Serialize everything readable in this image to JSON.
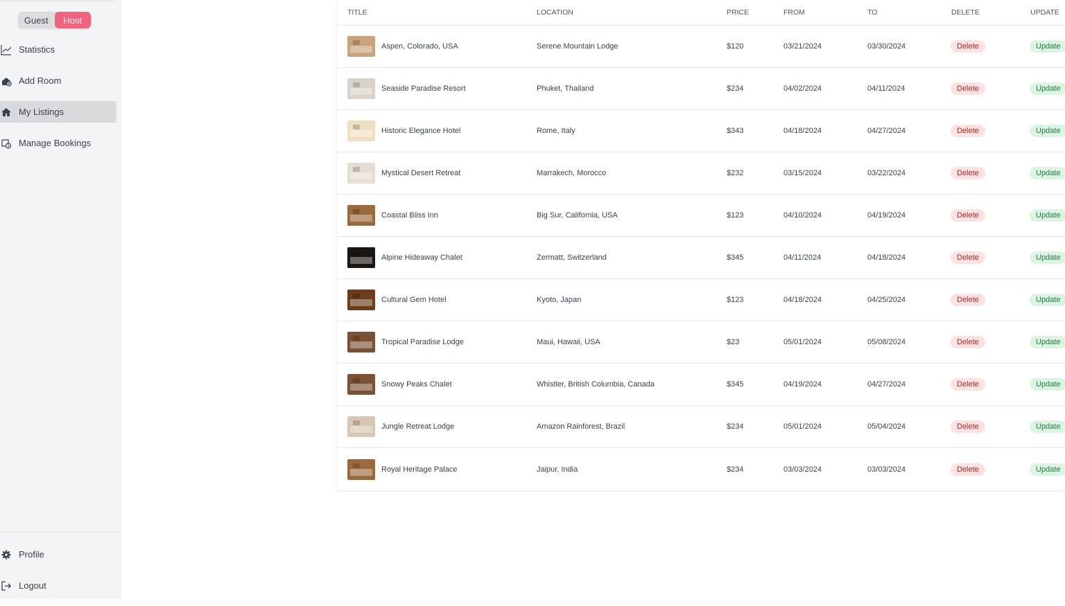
{
  "role_toggle": {
    "guest_label": "Guest",
    "host_label": "Host",
    "active": "host"
  },
  "sidebar": {
    "items": [
      {
        "label": "Statistics",
        "icon": "chart-line-icon",
        "active": false
      },
      {
        "label": "Add Room",
        "icon": "add-room-icon",
        "active": false
      },
      {
        "label": "My Listings",
        "icon": "home-icon",
        "active": true
      },
      {
        "label": "Manage Bookings",
        "icon": "bookings-icon",
        "active": false
      }
    ],
    "bottom": [
      {
        "label": "Profile",
        "icon": "gear-icon"
      },
      {
        "label": "Logout",
        "icon": "logout-icon"
      }
    ]
  },
  "table": {
    "headers": {
      "title": "Title",
      "location": "Location",
      "price": "Price",
      "from": "From",
      "to": "To",
      "delete": "Delete",
      "update": "Update"
    },
    "delete_label": "Delete",
    "update_label": "Update",
    "rows": [
      {
        "title": "Aspen, Colorado, USA",
        "location": "Serene Mountain Lodge",
        "price": "$120",
        "from": "03/21/2024",
        "to": "03/30/2024",
        "thumb": "#c9a47a"
      },
      {
        "title": "Seaside Paradise Resort",
        "location": "Phuket, Thailand",
        "price": "$234",
        "from": "04/02/2024",
        "to": "04/11/2024",
        "thumb": "#d8d2ca"
      },
      {
        "title": "Historic Elegance Hotel",
        "location": "Rome, Italy",
        "price": "$343",
        "from": "04/18/2024",
        "to": "04/27/2024",
        "thumb": "#f1dfc3"
      },
      {
        "title": "Mystical Desert Retreat",
        "location": "Marrakech, Morocco",
        "price": "$232",
        "from": "03/15/2024",
        "to": "03/22/2024",
        "thumb": "#e6ddd3"
      },
      {
        "title": "Coastal Bliss Inn",
        "location": "Big Sur, California, USA",
        "price": "$123",
        "from": "04/10/2024",
        "to": "04/19/2024",
        "thumb": "#9a6a3c"
      },
      {
        "title": "Alpine Hideaway Chalet",
        "location": "Zermatt, Switzerland",
        "price": "$345",
        "from": "04/11/2024",
        "to": "04/18/2024",
        "thumb": "#1c1613"
      },
      {
        "title": "Cultural Gem Hotel",
        "location": "Kyoto, Japan",
        "price": "$123",
        "from": "04/18/2024",
        "to": "04/25/2024",
        "thumb": "#6b3d1b"
      },
      {
        "title": "Tropical Paradise Lodge",
        "location": "Maui, Hawaii, USA",
        "price": "$23",
        "from": "05/01/2024",
        "to": "05/08/2024",
        "thumb": "#7a5233"
      },
      {
        "title": "Snowy Peaks Chalet",
        "location": "Whistler, British Columbia, Canada",
        "price": "$345",
        "from": "04/19/2024",
        "to": "04/27/2024",
        "thumb": "#7a5233"
      },
      {
        "title": "Jungle Retreat Lodge",
        "location": "Amazon Rainforest, Brazil",
        "price": "$234",
        "from": "05/01/2024",
        "to": "05/04/2024",
        "thumb": "#d8c7b4"
      },
      {
        "title": "Royal Heritage Palace",
        "location": "Jaipur, India",
        "price": "$234",
        "from": "03/03/2024",
        "to": "03/03/2024",
        "thumb": "#9a6a3c"
      }
    ]
  },
  "colors": {
    "host_active": "#f0627e",
    "delete_bg": "#fde2e2",
    "update_bg": "#dcf5e3",
    "sidebar_bg": "#f3f4f6"
  }
}
